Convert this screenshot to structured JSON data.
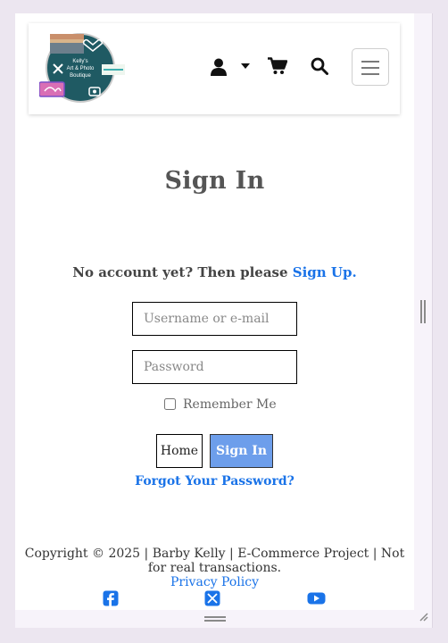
{
  "header": {
    "logo_text": [
      "Kelly's",
      "Art & Photo",
      "Boutique"
    ],
    "icons": {
      "account": "user-icon",
      "dropdown": "caret-down-icon",
      "cart": "shopping-cart-icon",
      "search": "search-icon",
      "menu": "hamburger-menu-icon"
    }
  },
  "main": {
    "title": "Sign In",
    "no_account_text": "No account yet? Then please",
    "signup_link": "Sign Up.",
    "username_placeholder": "Username or e-mail",
    "password_placeholder": "Password",
    "remember_label": "Remember Me",
    "remember_checked": false,
    "home_button": "Home",
    "signin_button": "Sign In",
    "forgot_link": "Forgot Your Password?"
  },
  "footer": {
    "copyright": "Copyright © 2025 | Barby Kelly | E-Commerce Project | Not for real transactions.",
    "privacy_link": "Privacy Policy",
    "social": [
      "facebook-icon",
      "x-twitter-icon",
      "youtube-icon"
    ]
  },
  "colors": {
    "link": "#1a73e8",
    "signin_button": "#6d9eeb",
    "logo_circle": "#1f5a63",
    "outer_background": "#ece6f0"
  }
}
